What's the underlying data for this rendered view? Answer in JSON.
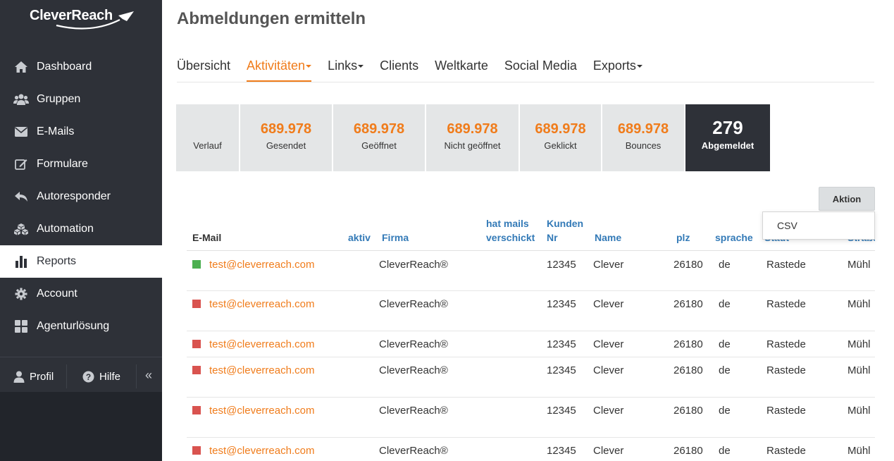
{
  "colors": {
    "accent": "#f07c1b",
    "link": "#337ab7",
    "sidebar": "#2e3138",
    "status_active": "#4caf50",
    "status_inactive": "#d9534f"
  },
  "logo": {
    "text": "CleverReach"
  },
  "sidebar": {
    "items": [
      {
        "label": "Dashboard",
        "icon": "home-icon"
      },
      {
        "label": "Gruppen",
        "icon": "users-icon"
      },
      {
        "label": "E-Mails",
        "icon": "envelope-icon"
      },
      {
        "label": "Formulare",
        "icon": "edit-icon"
      },
      {
        "label": "Autoresponder",
        "icon": "reply-icon"
      },
      {
        "label": "Automation",
        "icon": "cubes-icon"
      },
      {
        "label": "Reports",
        "icon": "bar-chart-icon",
        "active": true
      },
      {
        "label": "Account",
        "icon": "gear-icon"
      },
      {
        "label": "Agenturlösung",
        "icon": "grid-icon"
      }
    ],
    "profil": "Profil",
    "hilfe": "Hilfe",
    "collapse": "«"
  },
  "page": {
    "title": "Abmeldungen ermitteln"
  },
  "tabs": [
    {
      "label": "Übersicht"
    },
    {
      "label": "Aktivitäten",
      "active": true
    },
    {
      "label": "Links"
    },
    {
      "label": "Clients"
    },
    {
      "label": "Weltkarte"
    },
    {
      "label": "Social Media"
    },
    {
      "label": "Exports"
    }
  ],
  "stats": [
    {
      "label": "Verlauf",
      "value": ""
    },
    {
      "label": "Gesendet",
      "value": "689.978"
    },
    {
      "label": "Geöffnet",
      "value": "689.978"
    },
    {
      "label": "Nicht geöffnet",
      "value": "689.978"
    },
    {
      "label": "Geklickt",
      "value": "689.978"
    },
    {
      "label": "Bounces",
      "value": "689.978"
    },
    {
      "label": "Abgemeldet",
      "value": "279",
      "active": true
    }
  ],
  "aktion": {
    "label": "Aktion",
    "menu": [
      "CSV"
    ]
  },
  "table": {
    "headers": {
      "email": "E-Mail",
      "aktiv": "aktiv",
      "firma": "Firma",
      "hat_mails_1": "hat mails",
      "hat_mails_2": "verschickt",
      "kunden_1": "Kunden",
      "kunden_2": "Nr",
      "name": "Name",
      "plz": "plz",
      "sprache": "sprache",
      "stadt": "Stadt",
      "strasse": "Straße"
    },
    "rows": [
      {
        "status": "active",
        "email": "test@cleverreach.com",
        "firma": "CleverReach®",
        "kunden_nr": "12345",
        "name": "Clever",
        "plz": "26180",
        "sprache": "de",
        "stadt": "Rastede",
        "strasse": "Mühl"
      },
      {
        "status": "inactive",
        "email": "test@cleverreach.com",
        "firma": "CleverReach®",
        "kunden_nr": "12345",
        "name": "Clever",
        "plz": "26180",
        "sprache": "de",
        "stadt": "Rastede",
        "strasse": "Mühl"
      },
      {
        "status": "inactive",
        "email": "test@cleverreach.com",
        "firma": "CleverReach®",
        "kunden_nr": "12345",
        "name": "Clever",
        "plz": "26180",
        "sprache": "de",
        "stadt": "Rastede",
        "strasse": "Mühl"
      },
      {
        "status": "inactive",
        "email": "test@cleverreach.com",
        "firma": "CleverReach®",
        "kunden_nr": "12345",
        "name": "Clever",
        "plz": "26180",
        "sprache": "de",
        "stadt": "Rastede",
        "strasse": "Mühl"
      },
      {
        "status": "inactive",
        "email": "test@cleverreach.com",
        "firma": "CleverReach®",
        "kunden_nr": "12345",
        "name": "Clever",
        "plz": "26180",
        "sprache": "de",
        "stadt": "Rastede",
        "strasse": "Mühl"
      },
      {
        "status": "inactive",
        "email": "test@cleverreach.com",
        "firma": "CleverReach®",
        "kunden_nr": "12345",
        "name": "Clever",
        "plz": "26180",
        "sprache": "de",
        "stadt": "Rastede",
        "strasse": "Mühl"
      }
    ]
  }
}
